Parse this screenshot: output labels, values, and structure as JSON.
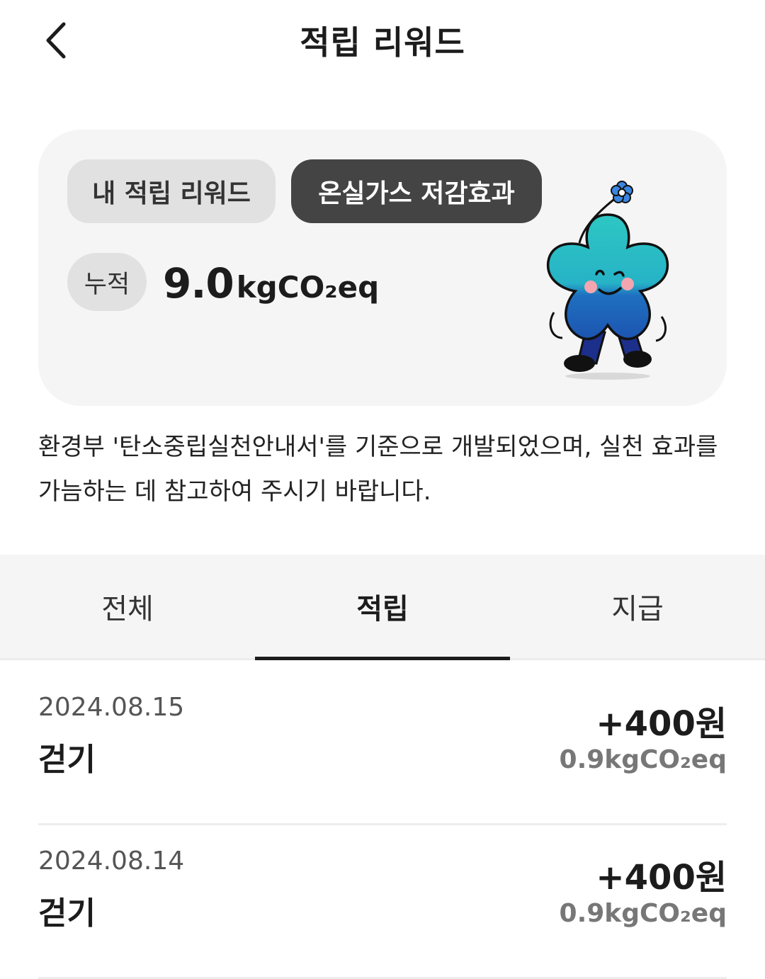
{
  "header": {
    "title": "적립 리워드"
  },
  "card": {
    "segments": [
      {
        "label": "내 적립 리워드",
        "selected": false
      },
      {
        "label": "온실가스 저감효과",
        "selected": true
      }
    ],
    "cumulative_label": "누적",
    "cumulative_value": "9.0",
    "cumulative_unit": "kgCO₂eq"
  },
  "notice": "환경부 '탄소중립실천안내서'를 기준으로 개발되었으며, 실천 효과를 가늠하는 데 참고하여 주시기 바랍니다.",
  "tabs": [
    {
      "label": "전체",
      "active": false
    },
    {
      "label": "적립",
      "active": true
    },
    {
      "label": "지급",
      "active": false
    }
  ],
  "records": [
    {
      "date": "2024.08.15",
      "title": "걷기",
      "amount": "+400원",
      "co2": "0.9kgCO₂eq"
    },
    {
      "date": "2024.08.14",
      "title": "걷기",
      "amount": "+400원",
      "co2": "0.9kgCO₂eq"
    }
  ],
  "colors": {
    "background": "#ffffff",
    "card": "#f5f5f5",
    "selected_segment": "#444444",
    "unselected_segment": "#e1e1e1",
    "mascot_top": "#2ec7c4",
    "mascot_bottom": "#1f5fb5"
  }
}
